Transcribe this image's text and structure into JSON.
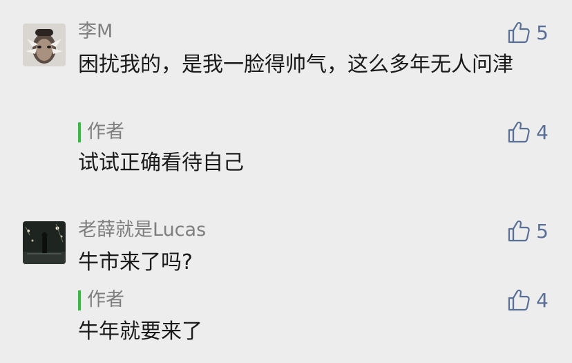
{
  "comments": [
    {
      "nickname": "李M",
      "text": "困扰我的，是我一脸得帅气，这么多年无人问津",
      "likes": "5",
      "reply": {
        "author_label": "作者",
        "text": "试试正确看待自己",
        "likes": "4"
      }
    },
    {
      "nickname": "老薛就是Lucas",
      "text": "牛市来了吗?",
      "likes": "5",
      "reply": {
        "author_label": "作者",
        "text": "牛年就要来了",
        "likes": "4"
      }
    }
  ],
  "colors": {
    "background": "#ededed",
    "like_blue": "#5a6f95",
    "author_bar_green": "#2fbf3a",
    "nickname_gray": "#7f7f7f"
  },
  "icons": {
    "like": "thumbs-up-icon"
  }
}
